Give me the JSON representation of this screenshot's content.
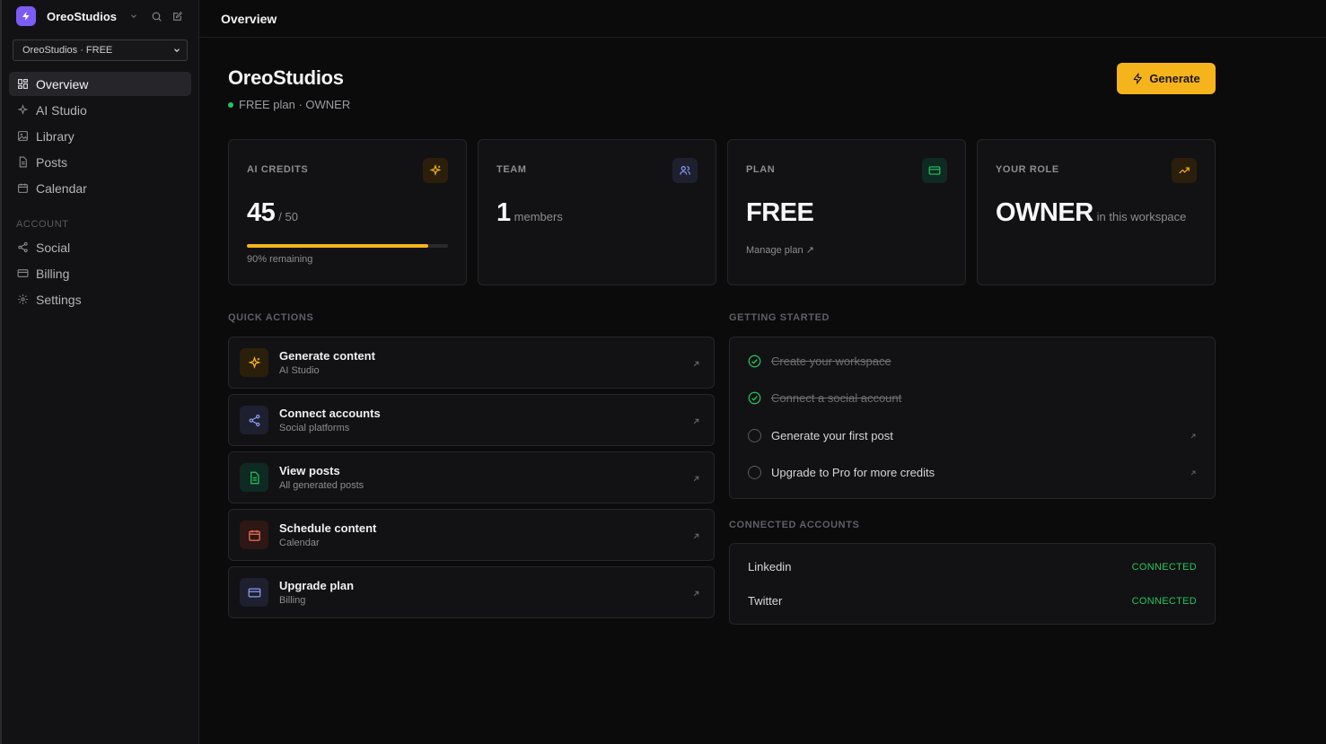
{
  "sidebar": {
    "brand": "OreoStudios",
    "workspace_select": "OreoStudios · FREE",
    "nav": [
      {
        "label": "Overview",
        "icon": "grid-icon",
        "active": true
      },
      {
        "label": "AI Studio",
        "icon": "sparkles-icon"
      },
      {
        "label": "Library",
        "icon": "image-icon"
      },
      {
        "label": "Posts",
        "icon": "file-icon"
      },
      {
        "label": "Calendar",
        "icon": "calendar-icon"
      }
    ],
    "account_label": "ACCOUNT",
    "account_nav": [
      {
        "label": "Social",
        "icon": "share-icon"
      },
      {
        "label": "Billing",
        "icon": "card-icon"
      },
      {
        "label": "Settings",
        "icon": "gear-icon"
      }
    ]
  },
  "topbar": {
    "title": "Overview"
  },
  "header": {
    "title": "OreoStudios",
    "subtitle": "FREE plan · OWNER",
    "generate_label": "Generate"
  },
  "cards": {
    "credits": {
      "label": "AI CREDITS",
      "value": "45",
      "suffix": "/ 50",
      "progress": 0.9,
      "note": "90% remaining"
    },
    "team": {
      "label": "TEAM",
      "value": "1",
      "suffix": "members"
    },
    "plan": {
      "label": "PLAN",
      "value": "FREE",
      "link": "Manage plan ↗"
    },
    "role": {
      "label": "YOUR ROLE",
      "value": "OWNER",
      "suffix": "in this workspace"
    }
  },
  "quick_actions": {
    "title": "QUICK ACTIONS",
    "items": [
      {
        "title": "Generate content",
        "sub": "AI Studio"
      },
      {
        "title": "Connect accounts",
        "sub": "Social platforms"
      },
      {
        "title": "View posts",
        "sub": "All generated posts"
      },
      {
        "title": "Schedule content",
        "sub": "Calendar"
      },
      {
        "title": "Upgrade plan",
        "sub": "Billing"
      }
    ]
  },
  "getting_started": {
    "title": "GETTING STARTED",
    "items": [
      {
        "label": "Create your workspace",
        "done": true
      },
      {
        "label": "Connect a social account",
        "done": true
      },
      {
        "label": "Generate your first post",
        "done": false
      },
      {
        "label": "Upgrade to Pro for more credits",
        "done": false
      }
    ]
  },
  "connected_accounts": {
    "title": "CONNECTED ACCOUNTS",
    "items": [
      {
        "name": "Linkedin",
        "status": "CONNECTED"
      },
      {
        "name": "Twitter",
        "status": "CONNECTED"
      }
    ]
  },
  "colors": {
    "accent": "#f5b41c",
    "brand": "#7c5cf6",
    "success": "#22c55e"
  }
}
